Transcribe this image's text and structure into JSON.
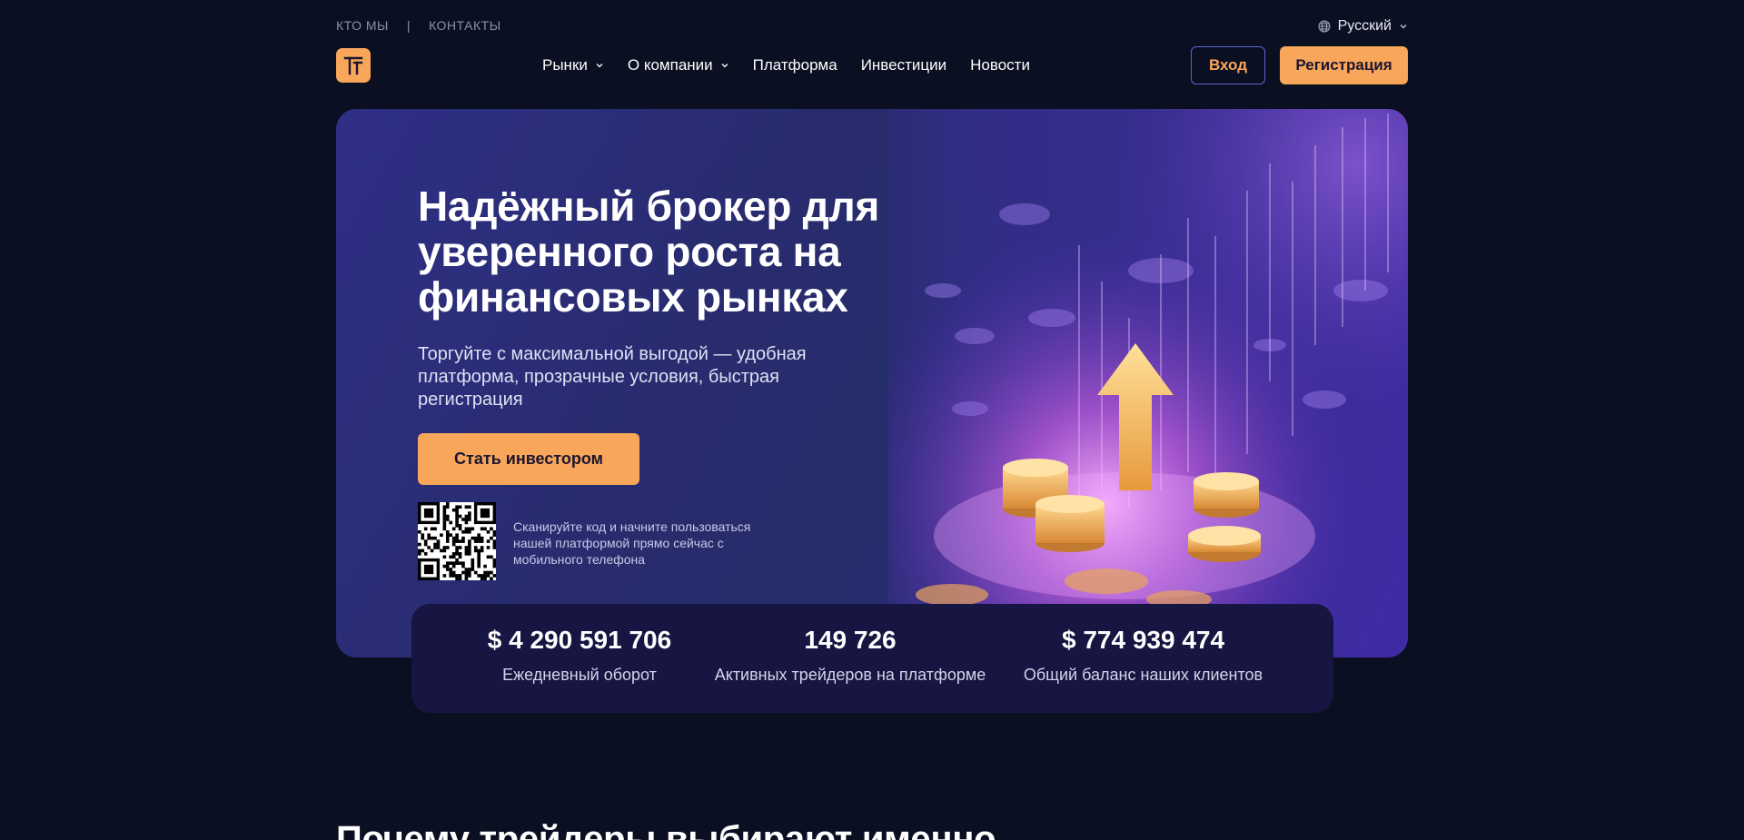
{
  "topbar": {
    "links": [
      "КТО МЫ",
      "КОНТАКТЫ"
    ],
    "separator": "|",
    "language": "Русский"
  },
  "nav": {
    "items": [
      {
        "label": "Рынки",
        "dropdown": true
      },
      {
        "label": "О компании",
        "dropdown": true
      },
      {
        "label": "Платформа",
        "dropdown": false
      },
      {
        "label": "Инвестиции",
        "dropdown": false
      },
      {
        "label": "Новости",
        "dropdown": false
      }
    ],
    "login": "Вход",
    "register": "Регистрация"
  },
  "hero": {
    "title_lines": [
      "Надёжный брокер для",
      "уверенного роста на",
      "финансовых рынках"
    ],
    "subtitle": "Торгуйте с максимальной выгодой — удобная платформа, прозрачные условия, быстрая регистрация",
    "cta": "Стать инвестором",
    "qr_caption": "Сканируйте код и начните пользоваться нашей платформой прямо сейчас с мобильного телефона"
  },
  "stats": [
    {
      "value": "$ 4 290 591 706",
      "label": "Ежедневный оборот"
    },
    {
      "value": "149 726",
      "label": "Активных трейдеров на платформе"
    },
    {
      "value": "$ 774 939 474",
      "label": "Общий баланс наших клиентов"
    }
  ],
  "section": {
    "title": "Почему трейдеры выбирают именно"
  },
  "colors": {
    "background": "#0b0f22",
    "accent": "#f8a65a",
    "hero": "#2b2d7a",
    "stats_panel": "#171541"
  },
  "icons": [
    "globe-icon",
    "chevron-down-icon",
    "logo-icon",
    "qr-code"
  ]
}
